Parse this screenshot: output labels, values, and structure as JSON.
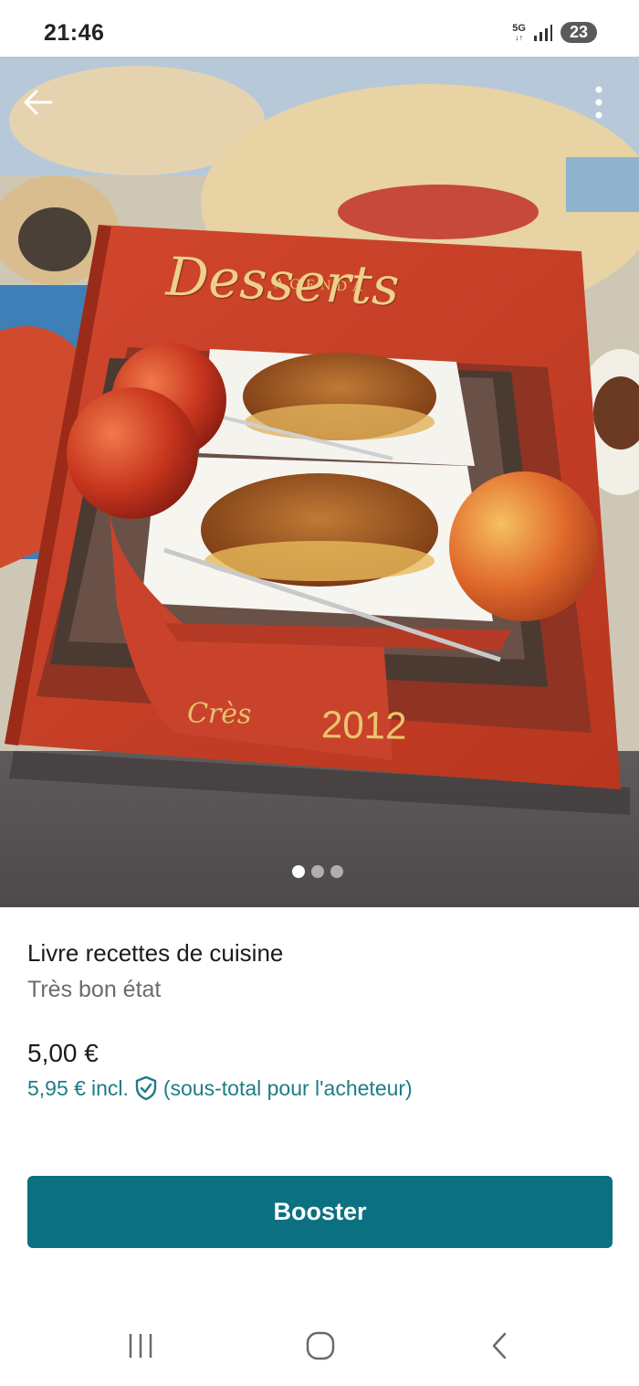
{
  "status_bar": {
    "time": "21:46",
    "network": "5G",
    "battery": "23",
    "icons": [
      "signal-icon",
      "battery-icon"
    ]
  },
  "photo": {
    "cover_heading": "AGENDA",
    "cover_title": "Desserts",
    "cover_year": "2012",
    "cover_publisher": "Crès",
    "gallery_page": 1,
    "gallery_count": 3
  },
  "item": {
    "title": "Livre recettes de cuisine",
    "condition": "Très bon état",
    "price": "5,00 €",
    "buyer_price": "5,95 €",
    "buyer_price_suffix": "incl.",
    "buyer_note": "(sous-total pour l'acheteur)"
  },
  "actions": {
    "booster_label": "Booster"
  },
  "colors": {
    "accent": "#0b7180",
    "link": "#1d7d86",
    "cover_red": "#c8402c"
  }
}
